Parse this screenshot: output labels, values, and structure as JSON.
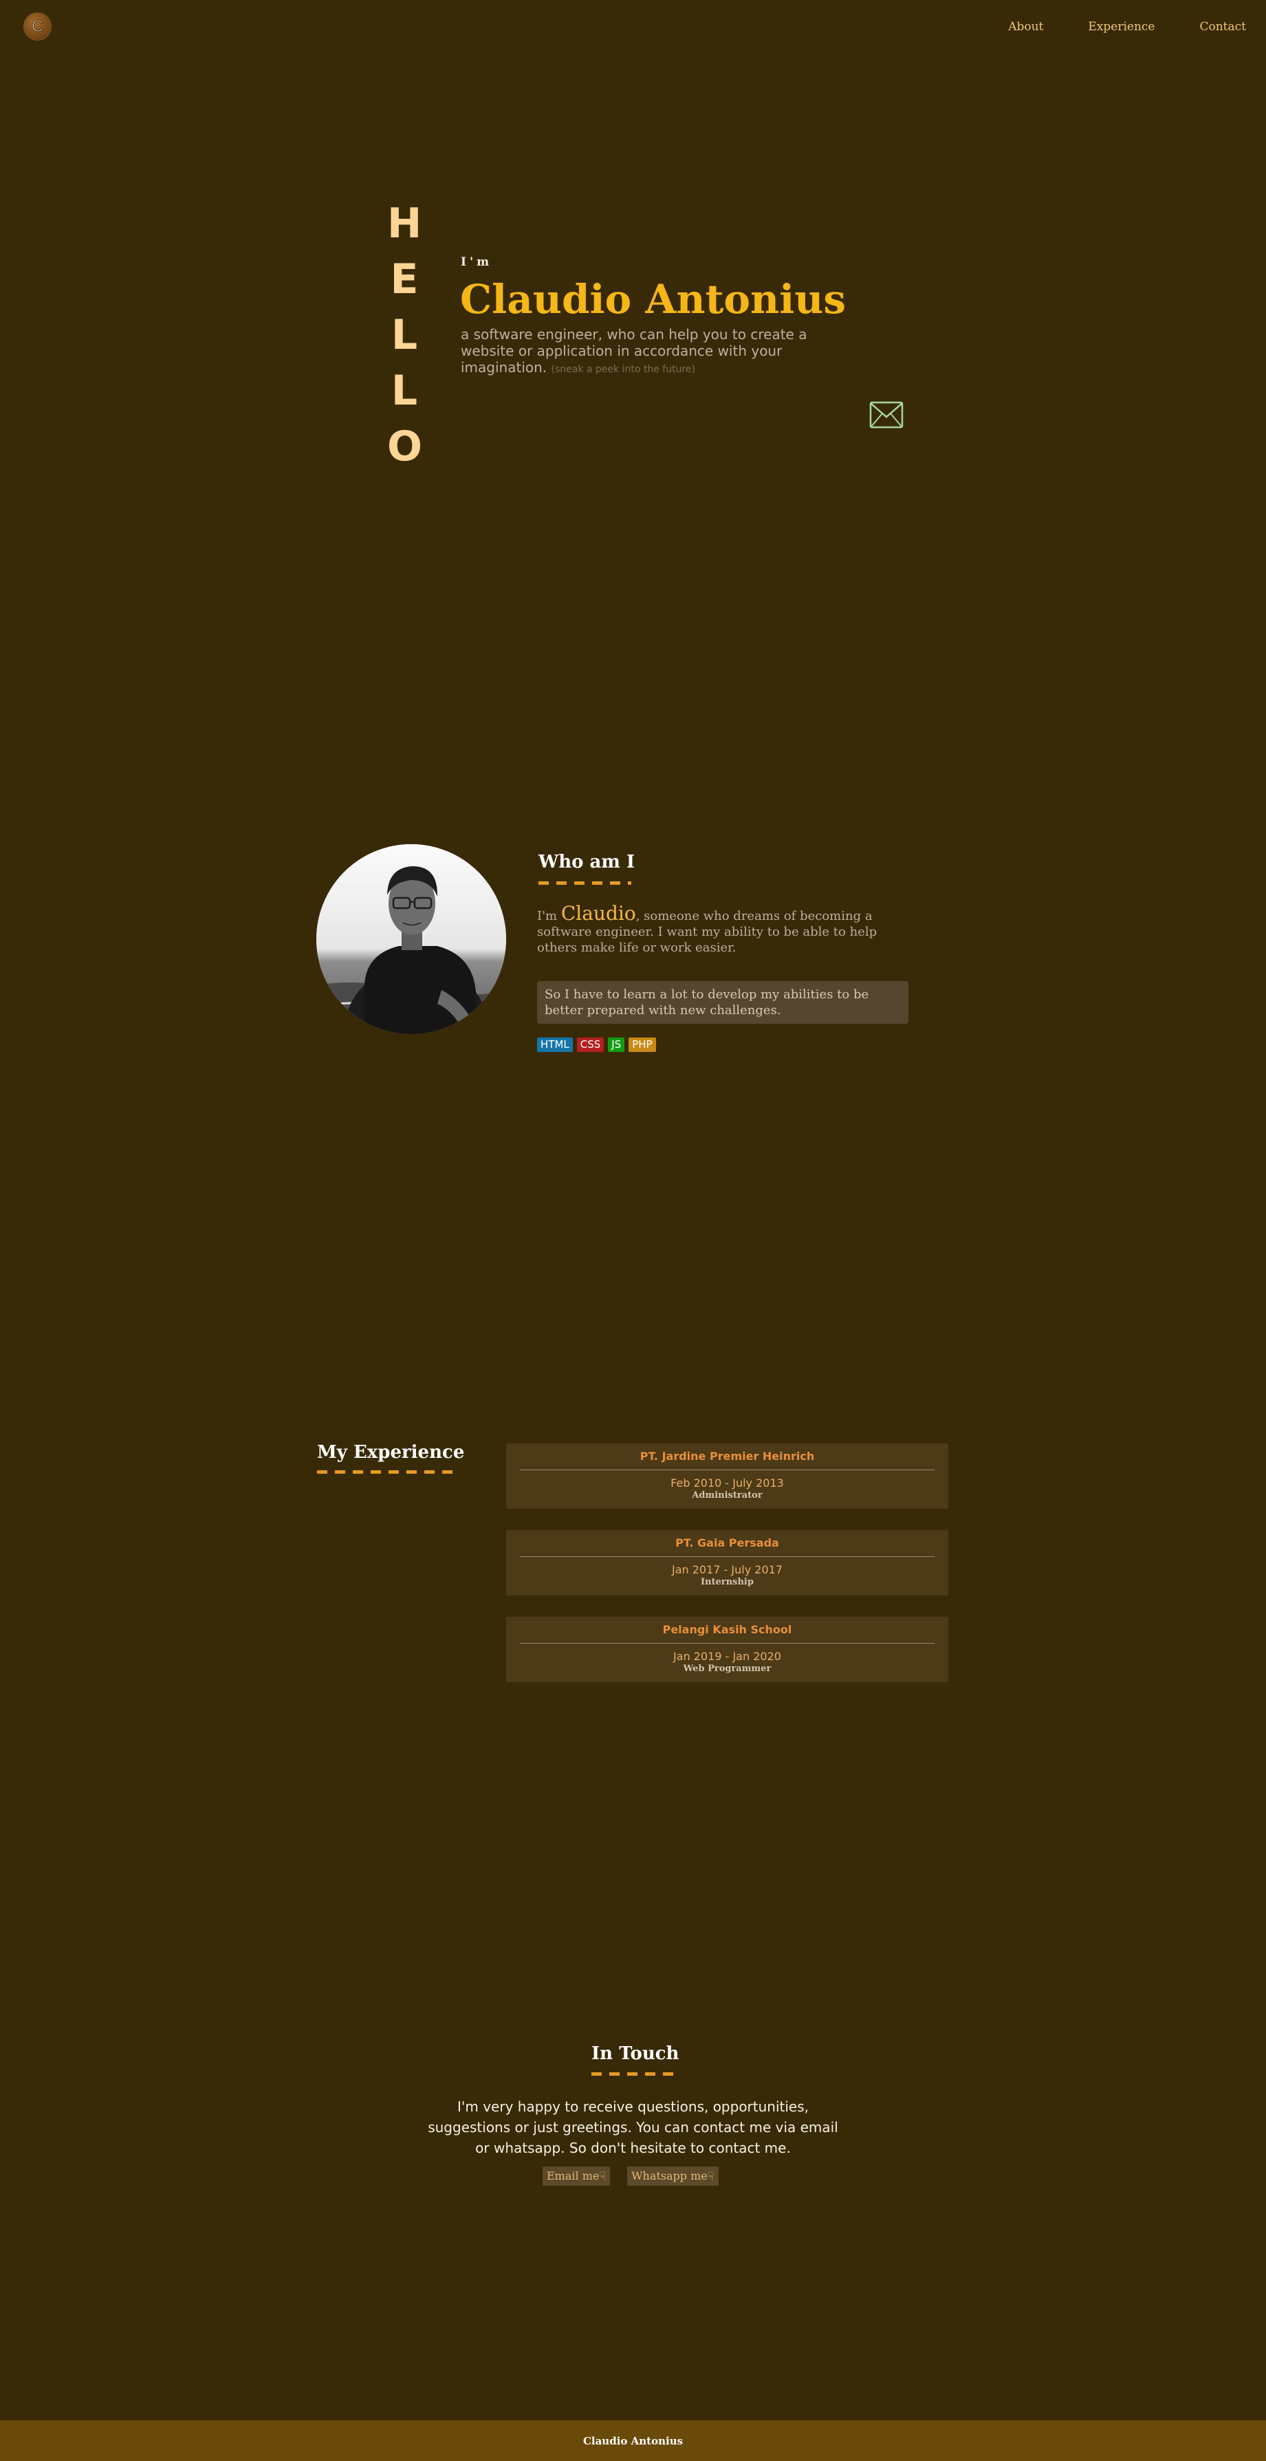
{
  "nav": {
    "logo_letter": "C",
    "items": [
      {
        "label": "About"
      },
      {
        "label": "Experience"
      },
      {
        "label": "Contact"
      }
    ]
  },
  "hero": {
    "hello_letters": [
      "H",
      "E",
      "L",
      "L",
      "O"
    ],
    "intro": "I'm",
    "name": "Claudio Antonius",
    "tagline": "a software engineer, who can help you to create a website or application in accordance with your imagination.",
    "peek": "(sneak a peek into the future)",
    "mail_icon": "envelope-icon"
  },
  "about": {
    "title": "Who am I",
    "text_prefix": "I'm ",
    "text_highlight": "Claudio",
    "text_suffix": ", someone who dreams of becoming a software engineer. I want my ability to be able to help others make life or work easier.",
    "quote": "So I have to learn a lot to develop my abilities to be better prepared with new challenges.",
    "skills": [
      {
        "label": "HTML",
        "color": "#1575a7"
      },
      {
        "label": "CSS",
        "color": "#b41f1f"
      },
      {
        "label": "JS",
        "color": "#149c14"
      },
      {
        "label": "PHP",
        "color": "#c98a15"
      }
    ]
  },
  "experience": {
    "title": "My Experience",
    "items": [
      {
        "company": "PT. Jardine Premier Heinrich",
        "period": "Feb 2010 - July 2013",
        "role": "Administrator"
      },
      {
        "company": "PT. Gaia Persada",
        "period": "Jan 2017 - July 2017",
        "role": "Internship"
      },
      {
        "company": "Pelangi Kasih School",
        "period": "Jan 2019 - Jan 2020",
        "role": "Web Programmer"
      }
    ]
  },
  "contact": {
    "title": "In Touch",
    "text": "I'm very happy to receive questions, opportunities, suggestions or just greetings. You can contact me via email or whatsapp. So don't hesitate to contact me.",
    "email_button": "Email me☟",
    "whatsapp_button": "Whatsapp me☟"
  },
  "footer": {
    "name": "Claudio Antonius"
  },
  "colors": {
    "background": "#392a07",
    "accent": "#f5b618",
    "footer": "#6a4a09"
  }
}
